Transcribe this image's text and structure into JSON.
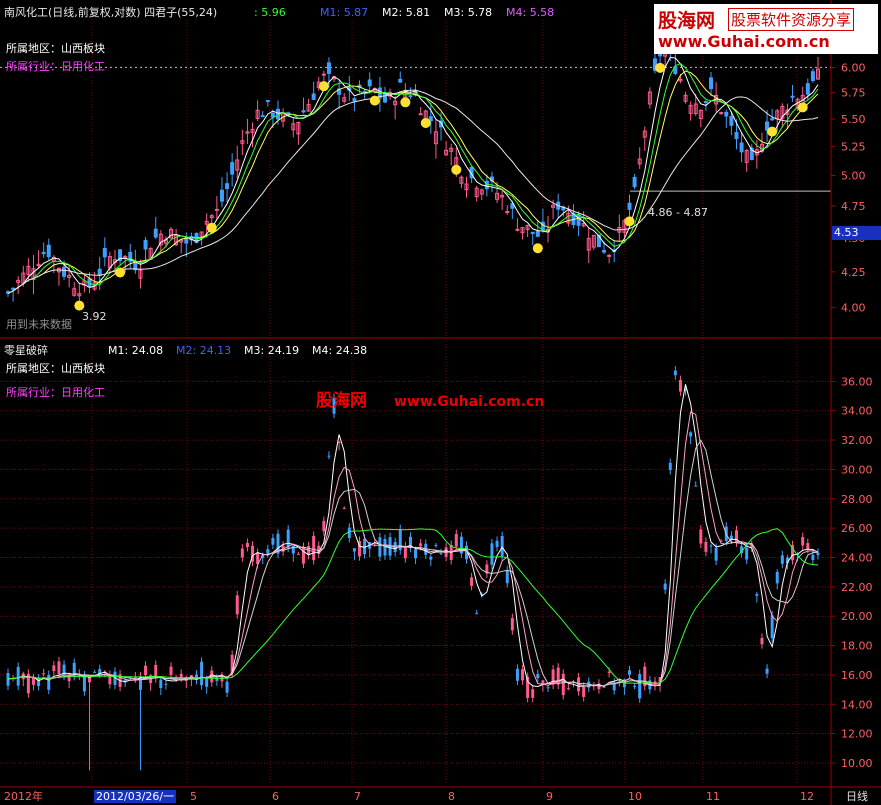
{
  "top_panel": {
    "title": "南风化工(日线,前复权,对数) 四君子(55,24)",
    "value_label": ": 5.96",
    "m1": "M1: 5.87",
    "m2": "M2: 5.81",
    "m3": "M3: 5.78",
    "m4": "M4: 5.58",
    "region": "所属地区：山西板块",
    "industry": "所属行业：日用化工",
    "low_label": "3.92",
    "range_label": "4.86 - 4.87",
    "price_tag": "4.53",
    "future_note": "用到未来数据"
  },
  "bottom_panel": {
    "title": "零星破碎",
    "m1": "M1: 24.08",
    "m2": "M2: 24.13",
    "m3": "M3: 24.19",
    "m4": "M4: 24.38",
    "region": "所属地区：山西板块",
    "industry": "所属行业：日用化工"
  },
  "watermark": {
    "site_name": "股海网",
    "url": "www.Guhai.com.cn",
    "logo_name": "股海网",
    "logo_tag": "股票软件资源分享",
    "logo_url": "www.Guhai.com.cn"
  },
  "x_axis": {
    "labels": [
      "2012年",
      "2012/03/26/一",
      "5",
      "6",
      "7",
      "8",
      "9",
      "10",
      "11",
      "12"
    ],
    "period": "日线"
  },
  "colors": {
    "up": "#ff5a8c",
    "down": "#3da0ff",
    "ma_white": "#ffffff",
    "ma_pink": "#ffa0c8",
    "ma_yellow": "#ffff60",
    "ma_green": "#30ff30",
    "grid": "#7a0000",
    "axis_text": "#ff6060"
  },
  "chart_data": [
    {
      "type": "candlestick",
      "title": "南风化工(日线,前复权,对数) 四君子(55,24)",
      "y_scale": "log",
      "ylim": [
        3.82,
        6.5
      ],
      "y_ticks": [
        4.0,
        4.25,
        4.5,
        4.75,
        5.0,
        5.25,
        5.5,
        5.75,
        6.0,
        6.25
      ],
      "x_labels": [
        "2012年",
        "2012/03/26/一",
        "5",
        "6",
        "7",
        "8",
        "9",
        "10",
        "11",
        "12"
      ],
      "close_series": [
        4.1,
        4.2,
        4.32,
        4.42,
        4.28,
        4.18,
        4.12,
        4.25,
        4.38,
        4.35,
        4.3,
        4.48,
        4.55,
        4.5,
        4.45,
        4.62,
        4.7,
        4.95,
        5.3,
        5.55,
        5.6,
        5.5,
        5.45,
        5.65,
        5.9,
        5.85,
        5.7,
        5.72,
        5.78,
        5.65,
        5.8,
        5.75,
        5.55,
        5.4,
        5.2,
        5.0,
        4.95,
        4.9,
        4.8,
        4.62,
        4.55,
        4.5,
        4.78,
        4.7,
        4.6,
        4.48,
        4.4,
        4.55,
        4.85,
        5.6,
        6.2,
        6.05,
        5.7,
        5.65,
        5.75,
        5.5,
        5.25,
        5.05,
        5.45,
        5.55,
        5.7,
        5.75,
        5.9
      ]
    },
    {
      "type": "line",
      "title": "零星破碎",
      "ylim": [
        8.5,
        38
      ],
      "y_ticks": [
        10.0,
        12.0,
        14.0,
        16.0,
        18.0,
        20.0,
        22.0,
        24.0,
        26.0,
        28.0,
        30.0,
        32.0,
        34.0,
        36.0
      ],
      "series": [
        {
          "name": "M1",
          "last": 24.08
        },
        {
          "name": "M2",
          "last": 24.13
        },
        {
          "name": "M3",
          "last": 24.19
        },
        {
          "name": "M4",
          "last": 24.38
        }
      ],
      "values": [
        15.8,
        15.9,
        15.7,
        15.8,
        16.0,
        15.8,
        15.7,
        15.9,
        15.8,
        15.7,
        15.9,
        15.8,
        15.6,
        15.8,
        15.7,
        15.9,
        15.8,
        15.6,
        24.5,
        24.6,
        24.4,
        24.8,
        24.5,
        24.3,
        24.6,
        35.0,
        25.0,
        24.6,
        24.7,
        24.5,
        24.8,
        24.6,
        24.4,
        24.5,
        24.7,
        24.3,
        20.0,
        24.6,
        24.9,
        15.5,
        15.2,
        15.4,
        15.6,
        15.3,
        15.5,
        15.4,
        15.7,
        15.5,
        15.6,
        15.3,
        15.5,
        36.5,
        35.0,
        25.2,
        24.8,
        24.9,
        25.0,
        24.7,
        15.2,
        23.8,
        24.6,
        24.4,
        24.1
      ]
    }
  ]
}
